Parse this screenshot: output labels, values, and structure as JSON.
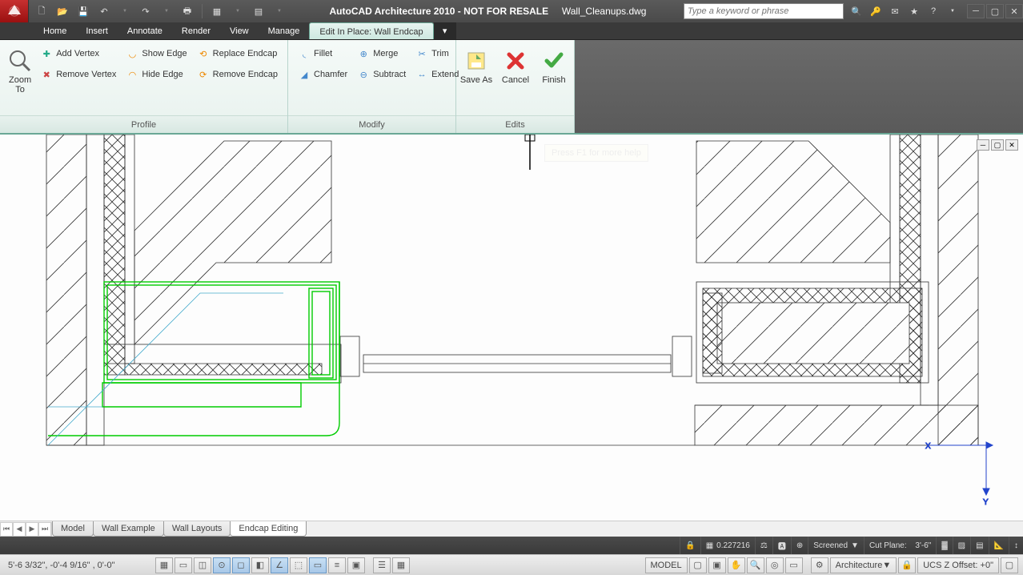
{
  "title": {
    "app": "AutoCAD Architecture 2010",
    "tag": "NOT FOR RESALE",
    "file": "Wall_Cleanups.dwg"
  },
  "search": {
    "placeholder": "Type a keyword or phrase"
  },
  "menus": {
    "home": "Home",
    "insert": "Insert",
    "annotate": "Annotate",
    "render": "Render",
    "view": "View",
    "manage": "Manage",
    "eip": "Edit In Place: Wall Endcap"
  },
  "ribbon": {
    "zoomto": "Zoom To",
    "addvertex": "Add Vertex",
    "removevertex": "Remove Vertex",
    "showedge": "Show Edge",
    "hideedge": "Hide Edge",
    "replaceendcap": "Replace Endcap",
    "removeendcap": "Remove Endcap",
    "fillet": "Fillet",
    "chamfer": "Chamfer",
    "merge": "Merge",
    "subtract": "Subtract",
    "trim": "Trim",
    "extend": "Extend",
    "saveas": "Save As",
    "cancel": "Cancel",
    "finish": "Finish",
    "panel_profile": "Profile",
    "panel_modify": "Modify",
    "panel_edits": "Edits"
  },
  "tooltip": "Press F1 for more help",
  "layout_tabs": {
    "model": "Model",
    "wallex": "Wall Example",
    "walllay": "Wall Layouts",
    "endcap": "Endcap Editing"
  },
  "status": {
    "scale": "0.227216",
    "screened": "Screened",
    "cutplane": "Cut Plane:",
    "cutplane_val": "3'-6\"",
    "arch": "Architecture",
    "ucs": "UCS Z Offset:",
    "ucs_val": "+0\"",
    "coords": "5'-6 3/32\",  -0'-4 9/16\" ,  0'-0\"",
    "model": "MODEL"
  }
}
